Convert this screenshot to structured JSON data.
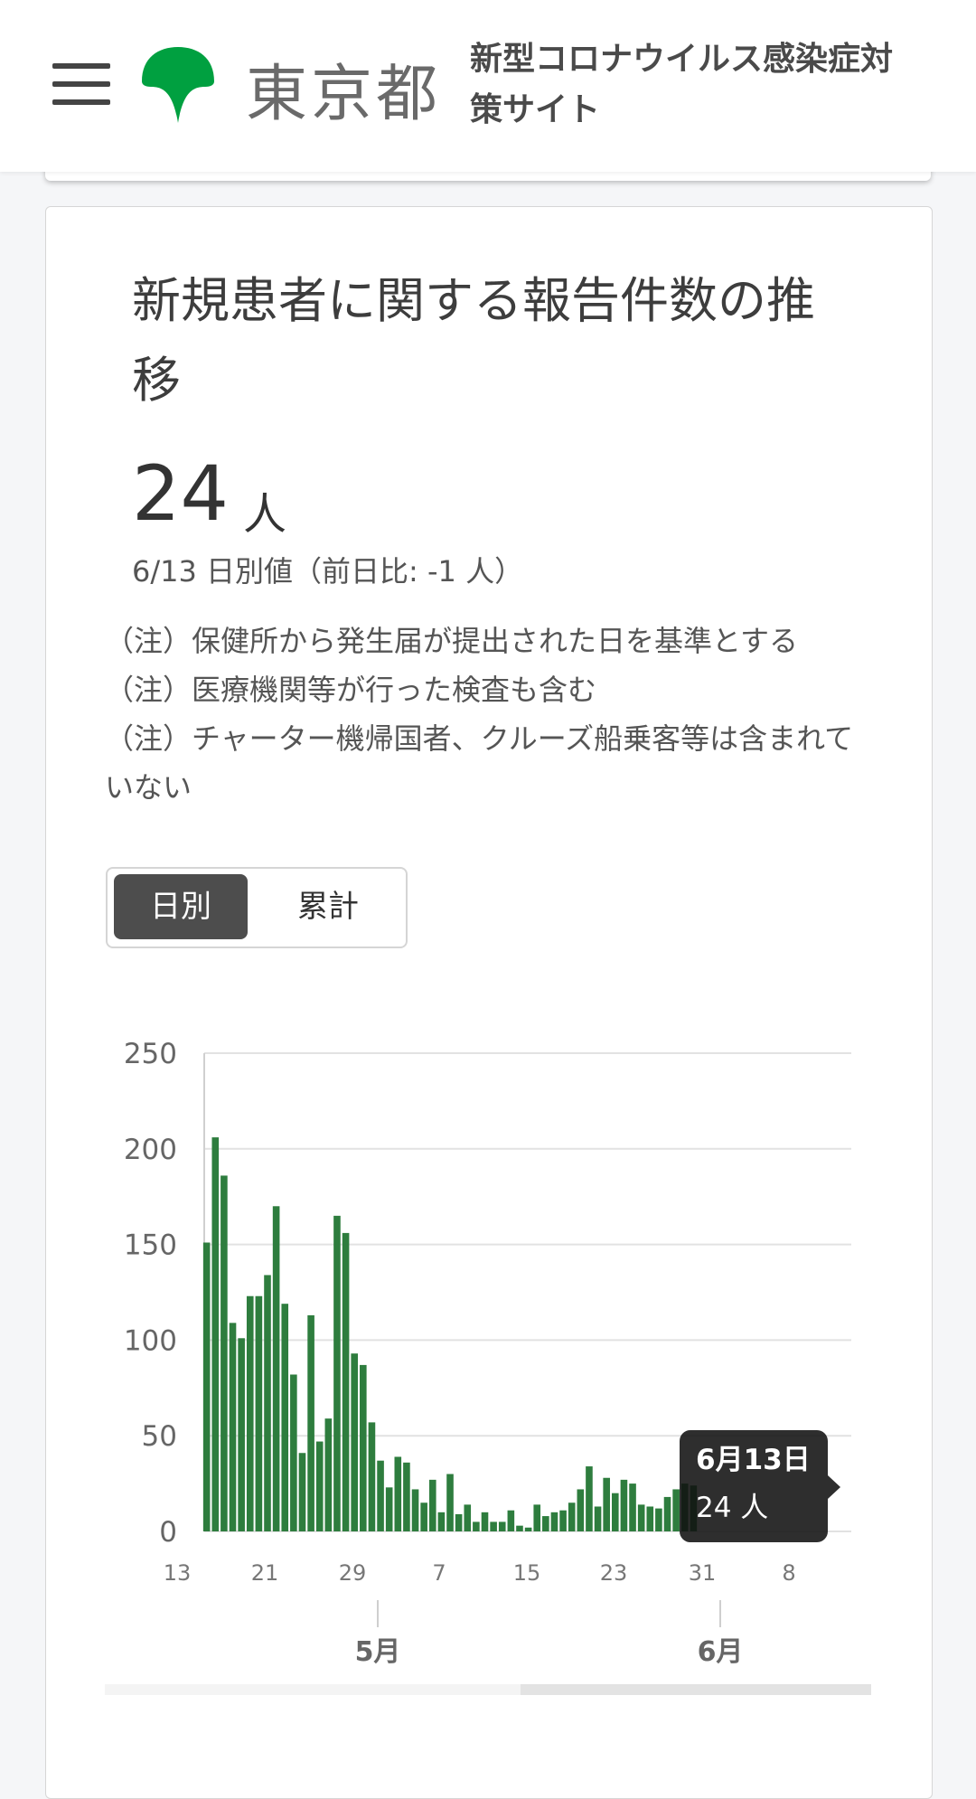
{
  "header": {
    "logo_text": "東京都",
    "site_title": "新型コロナウイルス感染症対策サイト",
    "menu_icon": "hamburger-menu-icon",
    "logo_icon": "ginkgo-leaf-icon",
    "logo_color": "#00a040"
  },
  "card": {
    "title": "新規患者に関する報告件数の推移",
    "value": "24",
    "unit": "人",
    "caption": "6/13 日別値（前日比: -1 人）",
    "notes": [
      "（注）保健所から発生届が提出された日を基準とする",
      "（注）医療機関等が行った検査も含む",
      "（注）チャーター機帰国者、クルーズ船乗客等は含まれていない"
    ],
    "toggle": {
      "daily_label": "日別",
      "cumulative_label": "累計",
      "selected": "日別"
    }
  },
  "tooltip": {
    "date": "6月13日",
    "value": "24 人"
  },
  "chart_data": {
    "type": "bar",
    "color": "#2e7d3e",
    "y_ticks": [
      "250",
      "200",
      "150",
      "100",
      "50",
      "0"
    ],
    "ylim": [
      0,
      250
    ],
    "x_ticks": [
      "13",
      "21",
      "29",
      "7",
      "15",
      "23",
      "31",
      "8"
    ],
    "month_labels": [
      "5月",
      "6月"
    ],
    "grid": true,
    "categories": [
      "4/13",
      "4/14",
      "4/15",
      "4/16",
      "4/17",
      "4/18",
      "4/19",
      "4/20",
      "4/21",
      "4/22",
      "4/23",
      "4/24",
      "4/25",
      "4/26",
      "4/27",
      "4/28",
      "4/29",
      "4/30",
      "5/1",
      "5/2",
      "5/3",
      "5/4",
      "5/5",
      "5/6",
      "5/7",
      "5/8",
      "5/9",
      "5/10",
      "5/11",
      "5/12",
      "5/13",
      "5/14",
      "5/15",
      "5/16",
      "5/17",
      "5/18",
      "5/19",
      "5/20",
      "5/21",
      "5/22",
      "5/23",
      "5/24",
      "5/25",
      "5/26",
      "5/27",
      "5/28",
      "5/29",
      "5/30",
      "5/31",
      "6/1",
      "6/2",
      "6/3",
      "6/4",
      "6/5",
      "6/6",
      "6/7",
      "6/8",
      "6/9",
      "6/10",
      "6/11",
      "6/12",
      "6/13"
    ],
    "values": [
      0,
      0,
      0,
      151,
      206,
      186,
      109,
      101,
      123,
      123,
      134,
      170,
      119,
      82,
      41,
      113,
      47,
      59,
      165,
      156,
      93,
      87,
      57,
      37,
      23,
      39,
      36,
      22,
      15,
      27,
      10,
      30,
      9,
      14,
      5,
      10,
      5,
      5,
      11,
      3,
      2,
      14,
      8,
      10,
      11,
      15,
      22,
      34,
      13,
      28,
      20,
      27,
      25,
      14,
      13,
      12,
      18,
      22,
      25,
      24
    ]
  }
}
